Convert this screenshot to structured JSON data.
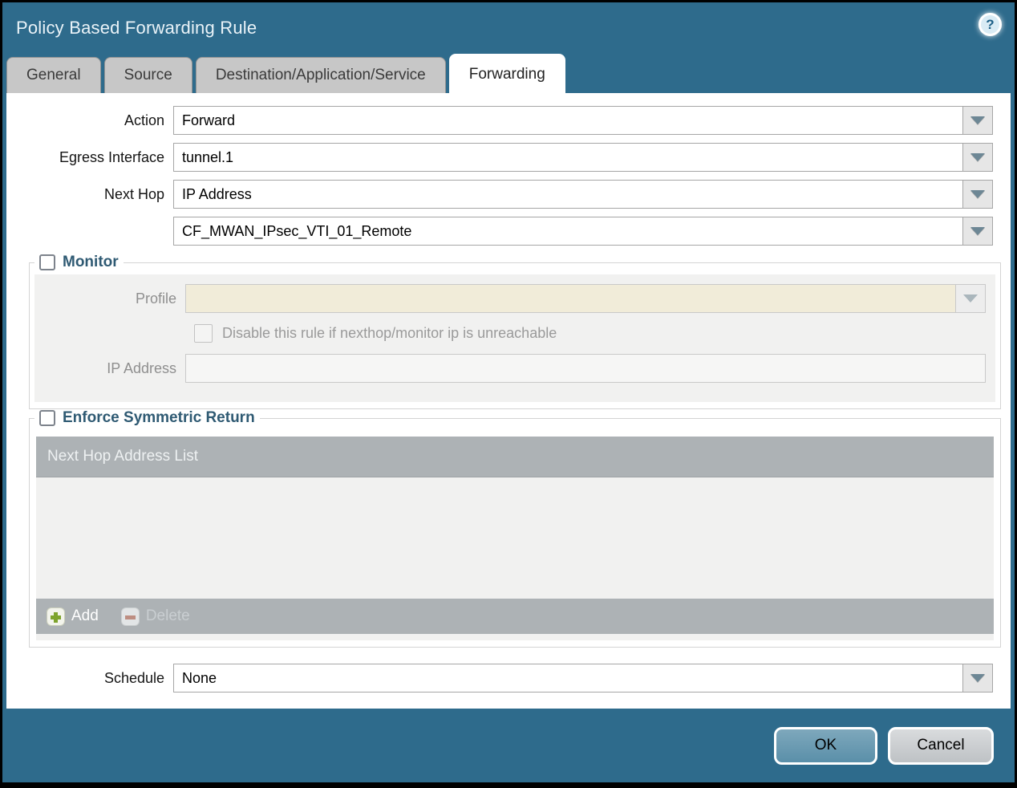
{
  "dialog": {
    "title": "Policy Based Forwarding Rule",
    "help_glyph": "?"
  },
  "tabs": [
    {
      "label": "General",
      "active": false
    },
    {
      "label": "Source",
      "active": false
    },
    {
      "label": "Destination/Application/Service",
      "active": false
    },
    {
      "label": "Forwarding",
      "active": true
    }
  ],
  "form": {
    "action": {
      "label": "Action",
      "value": "Forward"
    },
    "egress_interface": {
      "label": "Egress Interface",
      "value": "tunnel.1"
    },
    "next_hop": {
      "label": "Next Hop",
      "value": "IP Address"
    },
    "next_hop_address": {
      "value": "CF_MWAN_IPsec_VTI_01_Remote"
    },
    "schedule": {
      "label": "Schedule",
      "value": "None"
    }
  },
  "monitor": {
    "legend": "Monitor",
    "checked": false,
    "profile": {
      "label": "Profile",
      "value": ""
    },
    "disable_rule_label": "Disable this rule if nexthop/monitor ip is unreachable",
    "disable_rule_checked": false,
    "ip_address": {
      "label": "IP Address",
      "value": ""
    }
  },
  "symmetric_return": {
    "legend": "Enforce Symmetric Return",
    "checked": false,
    "table_header": "Next Hop Address List",
    "rows": [],
    "add_label": "Add",
    "delete_label": "Delete",
    "delete_enabled": false
  },
  "footer": {
    "ok_label": "OK",
    "cancel_label": "Cancel"
  },
  "colors": {
    "titlebar_teal": "#2e6b8c",
    "active_tab_bg": "#ffffff",
    "inactive_tab_bg": "#c7c7c7",
    "legend_text": "#2f5a73",
    "profile_disabled_bg": "#f1ecd9",
    "table_bar_gray": "#adb2b5",
    "add_icon_green": "#7da32c",
    "delete_icon_red": "#bd8e82",
    "ok_button_teal": "#5a8fa9",
    "cancel_button_gray": "#bec2c5"
  }
}
